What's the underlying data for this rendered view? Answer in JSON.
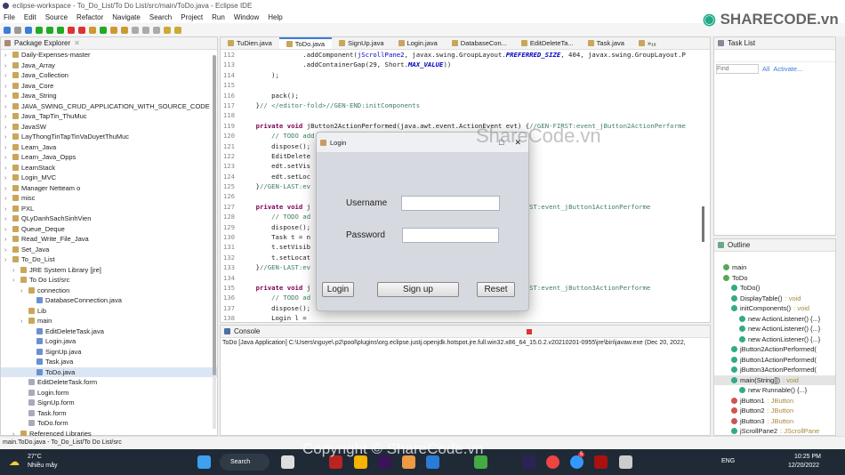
{
  "window": {
    "title": "eclipse-workspace - To_Do_List/To Do List/src/main/ToDo.java - Eclipse IDE"
  },
  "menu": [
    "File",
    "Edit",
    "Source",
    "Refactor",
    "Navigate",
    "Search",
    "Project",
    "Run",
    "Window",
    "Help"
  ],
  "package_explorer": {
    "title": "Package Explorer",
    "items": [
      {
        "label": "Daily-Expenses-master",
        "level": 0
      },
      {
        "label": "Java_Array",
        "level": 0
      },
      {
        "label": "Java_Collection",
        "level": 0
      },
      {
        "label": "Java_Core",
        "level": 0
      },
      {
        "label": "Java_String",
        "level": 0
      },
      {
        "label": "JAVA_SWING_CRUD_APPLICATION_WITH_SOURCE_CODE",
        "level": 0
      },
      {
        "label": "Java_TapTin_ThuMuc",
        "level": 0
      },
      {
        "label": "JavaSW",
        "level": 0
      },
      {
        "label": "LayThongTinTapTinVaDuyetThuMuc",
        "level": 0
      },
      {
        "label": "Learn_Java",
        "level": 0
      },
      {
        "label": "Learn_Java_Opps",
        "level": 0
      },
      {
        "label": "LearnStack",
        "level": 0
      },
      {
        "label": "Login_MVC",
        "level": 0
      },
      {
        "label": "Manager Netteam o",
        "level": 0
      },
      {
        "label": "misc",
        "level": 0
      },
      {
        "label": "PXL",
        "level": 0
      },
      {
        "label": "QLyDanhSachSinhVien",
        "level": 0
      },
      {
        "label": "Queue_Deque",
        "level": 0
      },
      {
        "label": "Read_Write_File_Java",
        "level": 0
      },
      {
        "label": "Set_Java",
        "level": 0
      },
      {
        "label": "To_Do_List",
        "level": 0
      },
      {
        "label": "JRE System Library [jre]",
        "level": 1
      },
      {
        "label": "To Do List/src",
        "level": 1
      },
      {
        "label": "connection",
        "level": 2
      },
      {
        "label": "DatabaseConnection.java",
        "level": 3
      },
      {
        "label": "Lib",
        "level": 2
      },
      {
        "label": "main",
        "level": 2
      },
      {
        "label": "EditDeleteTask.java",
        "level": 3
      },
      {
        "label": "Login.java",
        "level": 3
      },
      {
        "label": "SignUp.java",
        "level": 3
      },
      {
        "label": "Task.java",
        "level": 3
      },
      {
        "label": "ToDo.java",
        "level": 3
      },
      {
        "label": "EditDeleteTask.form",
        "level": 2
      },
      {
        "label": "Login.form",
        "level": 2
      },
      {
        "label": "SignUp.form",
        "level": 2
      },
      {
        "label": "Task.form",
        "level": 2
      },
      {
        "label": "ToDo.form",
        "level": 2
      },
      {
        "label": "Referenced Libraries",
        "level": 1
      }
    ]
  },
  "editor": {
    "tabs": [
      "TuDien.java",
      "ToDo.java",
      "SignUp.java",
      "Login.java",
      "DatabaseCon...",
      "EditDeleteTa...",
      "Task.java",
      "»₁₈"
    ],
    "active_tab": 1,
    "lines": [
      {
        "n": "112",
        "t": "                .addComponent(jScrollPane2, javax.swing.GroupLayout.PREFERRED_SIZE, 404, javax.swing.GroupLayout.P"
      },
      {
        "n": "113",
        "t": "                .addContainerGap(29, Short.MAX_VALUE))"
      },
      {
        "n": "114",
        "t": "        );"
      },
      {
        "n": "115",
        "t": ""
      },
      {
        "n": "116",
        "t": "        pack();"
      },
      {
        "n": "117",
        "t": "    }// </editor-fold>//GEN-END:initComponents"
      },
      {
        "n": "118",
        "t": ""
      },
      {
        "n": "119",
        "t": "    private void jButton2ActionPerformed(java.awt.event.ActionEvent evt) {//GEN-FIRST:event_jButton2ActionPerforme"
      },
      {
        "n": "120",
        "t": "        // TODO add your handling code here:"
      },
      {
        "n": "121",
        "t": "        dispose();"
      },
      {
        "n": "122",
        "t": "        EditDelete"
      },
      {
        "n": "123",
        "t": "        edt.setVis"
      },
      {
        "n": "124",
        "t": "        edt.setLoc"
      },
      {
        "n": "125",
        "t": "    }//GEN-LAST:ev"
      },
      {
        "n": "126",
        "t": ""
      },
      {
        "n": "127",
        "t": "    private void j                                              {//GEN-FIRST:event_jButton1ActionPerforme"
      },
      {
        "n": "128",
        "t": "        // TODO ad"
      },
      {
        "n": "129",
        "t": "        dispose();"
      },
      {
        "n": "130",
        "t": "        Task t = n"
      },
      {
        "n": "131",
        "t": "        t.setVisib"
      },
      {
        "n": "132",
        "t": "        t.setLocat"
      },
      {
        "n": "133",
        "t": "    }//GEN-LAST:ev"
      },
      {
        "n": "134",
        "t": ""
      },
      {
        "n": "135",
        "t": "    private void j                                              {//GEN-FIRST:event_jButton3ActionPerforme"
      },
      {
        "n": "136",
        "t": "        // TODO ad"
      },
      {
        "n": "137",
        "t": "        dispose();"
      },
      {
        "n": "138",
        "t": "        Login l = "
      },
      {
        "n": "139",
        "t": "        l.setVisib"
      },
      {
        "n": "140",
        "t": "        l.setLocat"
      },
      {
        "n": "141",
        "t": "    }//GEN-LAST:ev"
      }
    ]
  },
  "dialog": {
    "title": "Login",
    "username_label": "Username",
    "password_label": "Password",
    "username_value": "",
    "password_value": "",
    "login": "Login",
    "signup": "Sign up",
    "reset": "Reset"
  },
  "console": {
    "title": "Console",
    "text": "ToDo [Java Application] C:\\Users\\nguye\\.p2\\pool\\plugins\\org.eclipse.justj.openjdk.hotspot.jre.full.win32.x86_64_15.0.2.v20210201-0955\\jre\\bin\\javaw.exe  (Dec 20, 2022,"
  },
  "task_list": {
    "title": "Task List",
    "find_placeholder": "Find",
    "all": "All",
    "activate": "Activate..."
  },
  "outline": {
    "title": "Outline",
    "items": [
      {
        "label": "main",
        "type": "",
        "level": 0
      },
      {
        "label": "ToDo",
        "type": "",
        "level": 0
      },
      {
        "label": "ToDo()",
        "type": "",
        "level": 1
      },
      {
        "label": "DisplayTable()",
        "type": " : void",
        "level": 1
      },
      {
        "label": "initComponents()",
        "type": " : void",
        "level": 1
      },
      {
        "label": "new ActionListener() {...}",
        "type": "",
        "level": 2
      },
      {
        "label": "new ActionListener() {...}",
        "type": "",
        "level": 2
      },
      {
        "label": "new ActionListener() {...}",
        "type": "",
        "level": 2
      },
      {
        "label": "jButton2ActionPerformed(",
        "type": "",
        "level": 1
      },
      {
        "label": "jButton1ActionPerformed(",
        "type": "",
        "level": 1
      },
      {
        "label": "jButton3ActionPerformed(",
        "type": "",
        "level": 1
      },
      {
        "label": "main(String[])",
        "type": " : void",
        "level": 1
      },
      {
        "label": "new Runnable() {...}",
        "type": "",
        "level": 2
      },
      {
        "label": "jButton1",
        "type": " : JButton",
        "level": 1
      },
      {
        "label": "jButton2",
        "type": " : JButton",
        "level": 1
      },
      {
        "label": "jButton3",
        "type": " : JButton",
        "level": 1
      },
      {
        "label": "jScrollPane2",
        "type": " : JScrollPane",
        "level": 1
      }
    ]
  },
  "status_bar": {
    "text": "main.ToDo.java - To_Do_List/To Do List/src"
  },
  "taskbar": {
    "weather_temp": "27°C",
    "weather_desc": "Nhiều mây",
    "search": "Search",
    "lang": "ENG",
    "time": "10:25 PM",
    "date": "12/20/2022",
    "notification_badge": "5"
  },
  "watermark": {
    "logo": "SHARECODE.vn",
    "center": "ShareCode.vn",
    "copyright": "Copyright © ShareCode.vn"
  },
  "colors": {
    "accent": "#3b7dd8",
    "keyword": "#7f0055",
    "comment": "#3f7f5f",
    "taskbar": "#1f2a36"
  }
}
